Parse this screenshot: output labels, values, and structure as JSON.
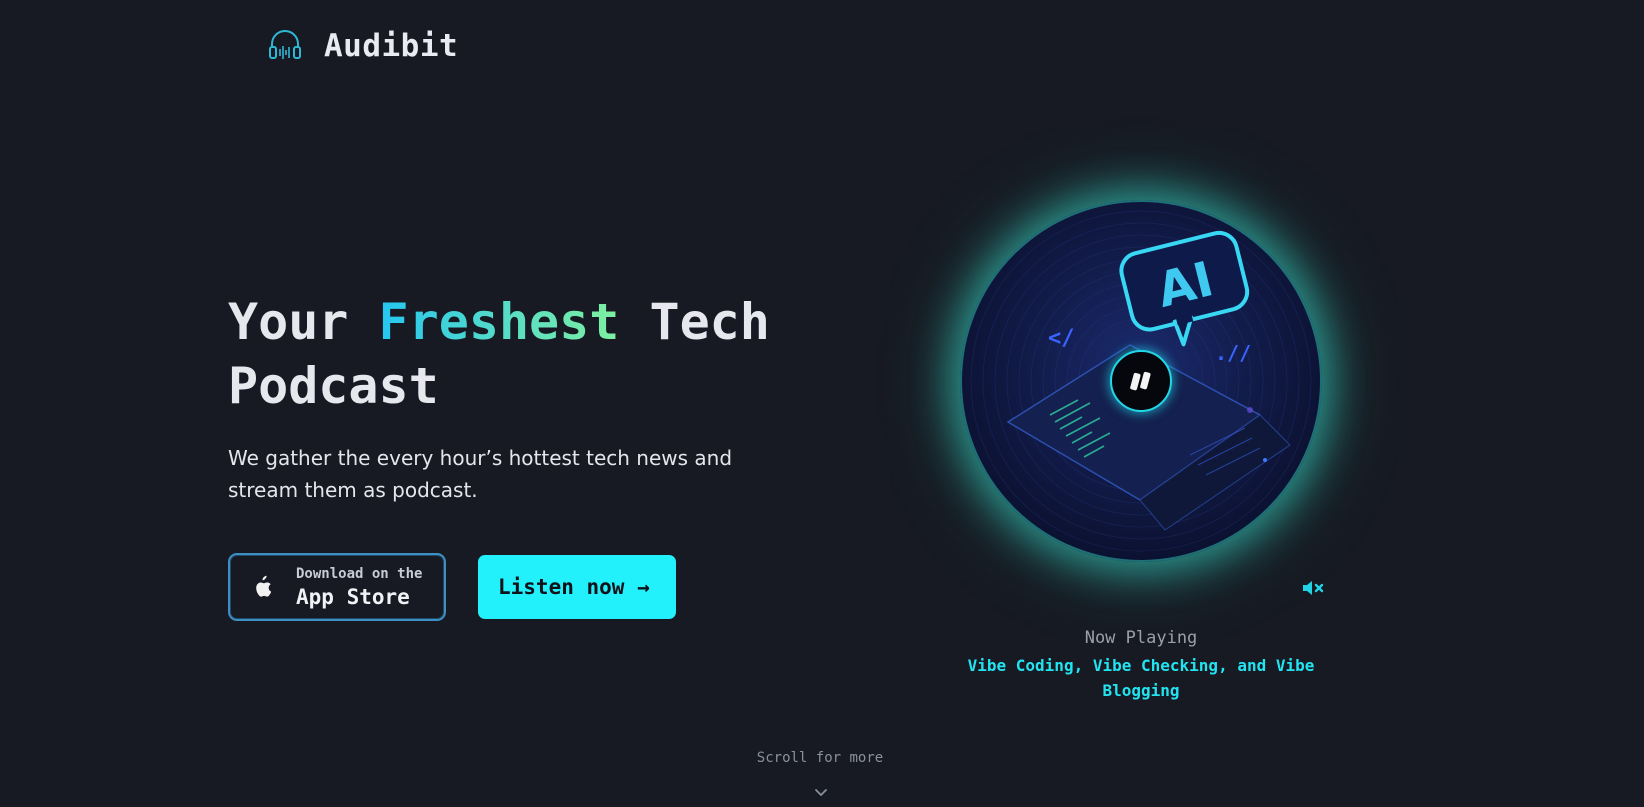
{
  "header": {
    "brand": "Audibit",
    "logo_icon": "headphones-waveform-icon",
    "accent": "#2fb8d6"
  },
  "hero": {
    "title_before": "Your",
    "title_highlight": "Freshest",
    "title_after_line1": "Tech",
    "title_line2": "Podcast",
    "subtitle": "We gather the every hour’s hottest tech news and stream them as podcast."
  },
  "buttons": {
    "store_small": "Download on the",
    "store_big": "App Store",
    "store_icon": "apple-icon",
    "listen": "Listen now →"
  },
  "player": {
    "disc_art": "AI chat bubble over laptop artwork",
    "disc_badge": "AI",
    "play_state_icon": "pause-icon",
    "mute_icon": "muted-speaker-icon",
    "now_playing_label": "Now Playing",
    "track_title": "Vibe Coding, Vibe Checking, and Vibe Blogging"
  },
  "footer": {
    "scroll_hint": "Scroll for more",
    "scroll_icon": "chevron-down-icon"
  },
  "colors": {
    "background": "#171a22",
    "cyan": "#22f0fb",
    "gradient_start": "#26c6f2",
    "gradient_end": "#7ef0a0",
    "glow": "#3adcc8"
  }
}
